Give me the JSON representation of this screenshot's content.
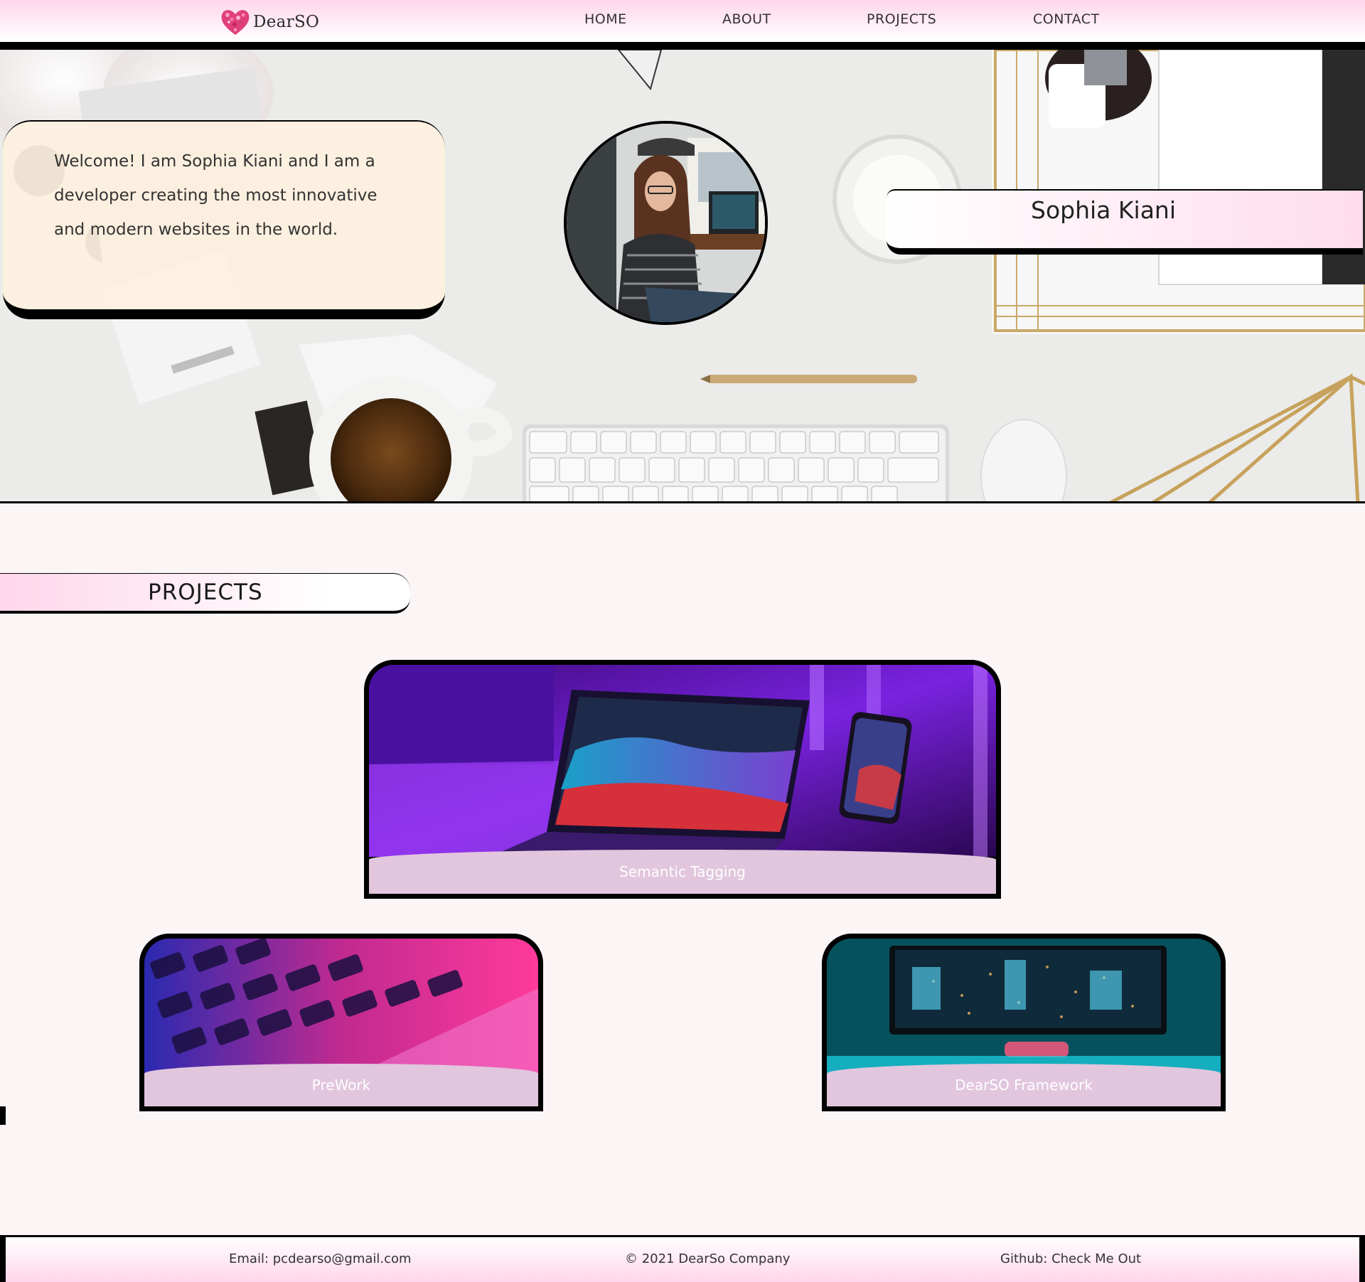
{
  "nav": {
    "brand": "DearSO",
    "links": [
      "HOME",
      "ABOUT",
      "PROJECTS",
      "CONTACT"
    ]
  },
  "hero": {
    "welcome_text": "Welcome! I am Sophia Kiani and I am a developer creating the most innovative and modern websites in the world.",
    "name": "Sophia Kiani"
  },
  "projects": {
    "heading": "PROJECTS",
    "items": [
      {
        "title": "Semantic Tagging"
      },
      {
        "title": "PreWork"
      },
      {
        "title": "DearSO Framework"
      }
    ]
  },
  "footer": {
    "email_label": "Email:",
    "email": "pcdearso@gmail.com",
    "copyright": "© 2021 DearSo Company",
    "github_label": "Github:",
    "github_link": "Check Me Out"
  },
  "colors": {
    "accent_pink": "#ffd6ea",
    "caption_lilac": "#e1c6dd",
    "page_background": "#fcf5f6",
    "welcome_card": "#fdf0df"
  },
  "icons": [
    "heart-logo-icon"
  ]
}
